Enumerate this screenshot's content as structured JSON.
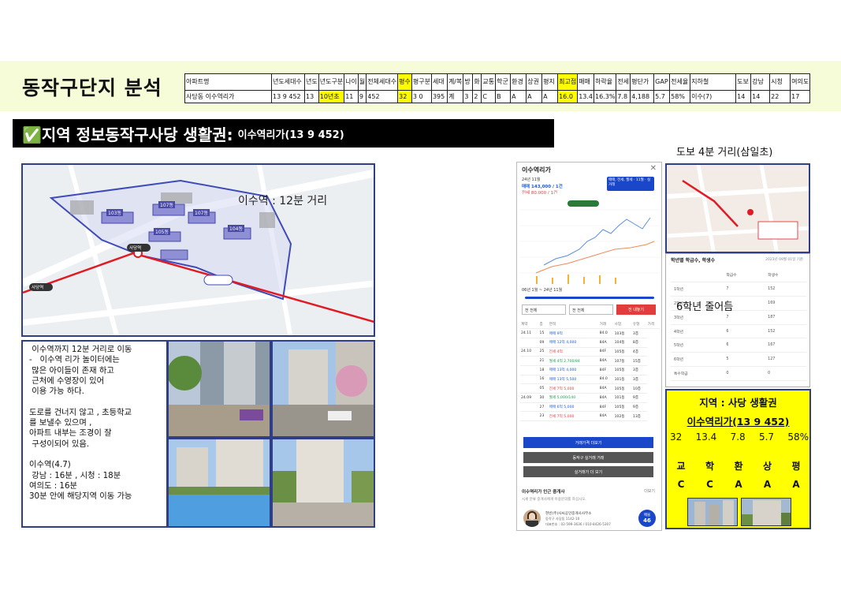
{
  "title": "동작구단지 분석",
  "summary_table": {
    "headers": [
      "아파트명",
      "년도세대수",
      "년도",
      "년도구분",
      "나이",
      "월",
      "전체세대수",
      "평수",
      "평구분",
      "세대",
      "계/복",
      "방",
      "화",
      "교통",
      "학군",
      "환경",
      "상권",
      "평지",
      "최고점",
      "매매",
      "하락율",
      "전세",
      "평단가",
      "GAP",
      "전세율",
      "지하철",
      "도보",
      "강남",
      "시청",
      "여의도"
    ],
    "values": [
      "사당동 이수역리가",
      "13 9 452",
      "13",
      "10년초",
      "11",
      "9",
      "452",
      "32",
      "3 0",
      "395",
      "계",
      "3",
      "2",
      "C",
      "B",
      "A",
      "A",
      "A",
      "16.0",
      "13.4",
      "16.3%",
      "7.8",
      "4,188",
      "5.7",
      "58%",
      "이수(7)",
      "14",
      "14",
      "22",
      "17"
    ]
  },
  "section": {
    "title": "✅지역 정보동작구사당 생활권:",
    "subtitle": "이수역리가(13 9 452)"
  },
  "map": {
    "distance_label": "이수역 : 12분 거리",
    "buildings": [
      "103동",
      "107동",
      "105동",
      "107동",
      "104동"
    ],
    "station_label": "사당역",
    "station_label2": "사당역"
  },
  "description": {
    "lines": [
      " 이수역까지 12분 거리로 이동",
      "-   이수역 리가 놀이터에는",
      " 많은 아이들이 존재 하고",
      " 근처에 수영장이 있어",
      " 이용 가능 하다.",
      "",
      "도로를 건너지 않고 , 초등학교",
      "를 보낼수 있으며 ,",
      "아파트 내부는 조경이 잘",
      " 구성이되어 있음.",
      "",
      "이수역(4.7)",
      " 강남 : 16분 , 시청 : 18분",
      "여의도 : 16분",
      "30분 안에 해당지역 이동 가능"
    ]
  },
  "phone": {
    "title": "이수역리가",
    "close": "✕",
    "sub": "24년 11월",
    "price_sale": "매매 143,000 / 1건",
    "price_jeonse": "전세 80,000 / 1건",
    "tab": "매매, 전세, 월세 · 11월 · 실거래",
    "range": "06년 1월 ~ 24년 11월",
    "select1": "전 전체",
    "select2": "전 전체",
    "red_button": "전 내놓기",
    "trade_header": [
      "계약",
      "층",
      "면적",
      "거래",
      "사업",
      "유형",
      "가격"
    ],
    "trades": [
      [
        "24.11",
        "15",
        "매매 9억",
        "84.0",
        "103동",
        "3층"
      ],
      [
        "",
        "09",
        "매매 12억 4,000",
        "84A",
        "104동",
        "8층"
      ],
      [
        "24.10",
        "25",
        "전세 4억",
        "84F",
        "105동",
        "4층"
      ],
      [
        "",
        "21",
        "월세 4억 2,700/84",
        "84A",
        "107동",
        "15층"
      ],
      [
        "",
        "18",
        "매매 13억 4,000",
        "84F",
        "105동",
        "3층"
      ],
      [
        "",
        "16",
        "매매 13억 5,500",
        "84.0",
        "101동",
        "3층"
      ],
      [
        "",
        "05",
        "전세 7억 5,000",
        "84A",
        "105동",
        "10층"
      ],
      [
        "24.09",
        "30",
        "월세 5,000/140",
        "84A",
        "101동",
        "9층"
      ],
      [
        "",
        "27",
        "매매 6억 5,000",
        "84F",
        "105동",
        "9층"
      ],
      [
        "",
        "23",
        "전세 7억 5,000",
        "84A",
        "102동",
        "13층"
      ]
    ],
    "btn1": "거래가격 더보기",
    "btn2": "동작구 실거래 거래",
    "btn3": "실거래가 더 보기",
    "agent_title": "이수역리가 인근 중개사",
    "agent_more": "더보기",
    "agent_note": "시세 분류 중개사에게 이용문의를 하십시오.",
    "agent_name": "현빈(주)사씨공인중개사사무소",
    "agent_sub": "동작구 사당동 1142-10",
    "agent_phone": "대표번호 : 02-599-3636 / 010-8426-5307",
    "agent_badge_label": "매물",
    "agent_badge_count": "46"
  },
  "school": {
    "caption": "도보 4분 거리(삼일초)",
    "panel_title": "학년별 학급수, 학생수",
    "date": "2023년 09월 01일 기준",
    "header": [
      "",
      "학급수",
      "학생수"
    ],
    "rows": [
      [
        "1학년",
        "7",
        "152"
      ],
      [
        "2학년",
        "7",
        "169"
      ],
      [
        "3학년",
        "7",
        "187"
      ],
      [
        "4학년",
        "6",
        "152"
      ],
      [
        "5학년",
        "6",
        "167"
      ],
      [
        "6학년",
        "5",
        "127"
      ],
      [
        "특수학급",
        "0",
        "0"
      ]
    ],
    "note": "6학년 줄어듬"
  },
  "summary_box": {
    "title": "지역 : 사당 생활권",
    "apartment": "이수역리가(13 9 452)",
    "stats": [
      "32",
      "13.4",
      "7.8",
      "5.7",
      "58%"
    ],
    "categories": [
      "교",
      "학",
      "환",
      "상",
      "평"
    ],
    "grades": [
      "C",
      "C",
      "A",
      "A",
      "A"
    ]
  },
  "colors": {
    "highlight": "#ffff00",
    "header_band": "#f6fbd8",
    "frame": "#2f3e86",
    "accent_blue": "#1a46c9",
    "accent_red": "#e23c3c",
    "route": "#e01b24"
  }
}
